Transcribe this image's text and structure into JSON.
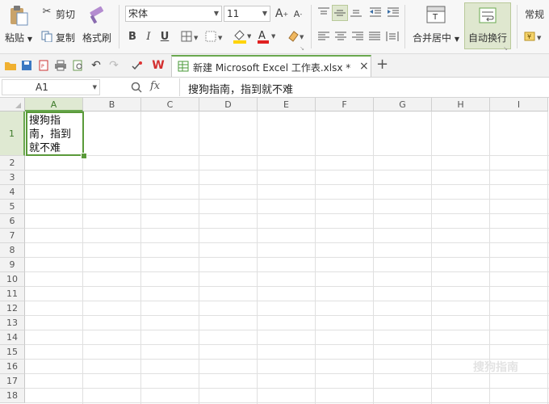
{
  "ribbon": {
    "paste_label": "粘贴",
    "cut_label": "剪切",
    "copy_label": "复制",
    "format_painter_label": "格式刷",
    "font_name": "宋体",
    "font_size": "11",
    "bold": "B",
    "italic": "I",
    "underline": "U",
    "font_color_glyph": "A",
    "merge_center_label": "合并居中",
    "wrap_text_label": "自动换行",
    "number_format": "常规",
    "accent_color": "#6aa84f"
  },
  "tabs": {
    "document_title": "新建 Microsoft Excel 工作表.xlsx *",
    "close_glyph": "×",
    "new_tab_glyph": "+"
  },
  "formula_bar": {
    "name_box": "A1",
    "fx_label": "fx",
    "content": "搜狗指南，指到就不难"
  },
  "sheet": {
    "columns": [
      "A",
      "B",
      "C",
      "D",
      "E",
      "F",
      "G",
      "H",
      "I"
    ],
    "rows": [
      "1",
      "2",
      "3",
      "4",
      "5",
      "6",
      "7",
      "8",
      "9",
      "10",
      "11",
      "12",
      "13",
      "14",
      "15",
      "16",
      "17",
      "18"
    ],
    "a1_lines": [
      "搜狗指",
      "南，指到",
      "就不难"
    ]
  },
  "watermark": "搜狗指南"
}
